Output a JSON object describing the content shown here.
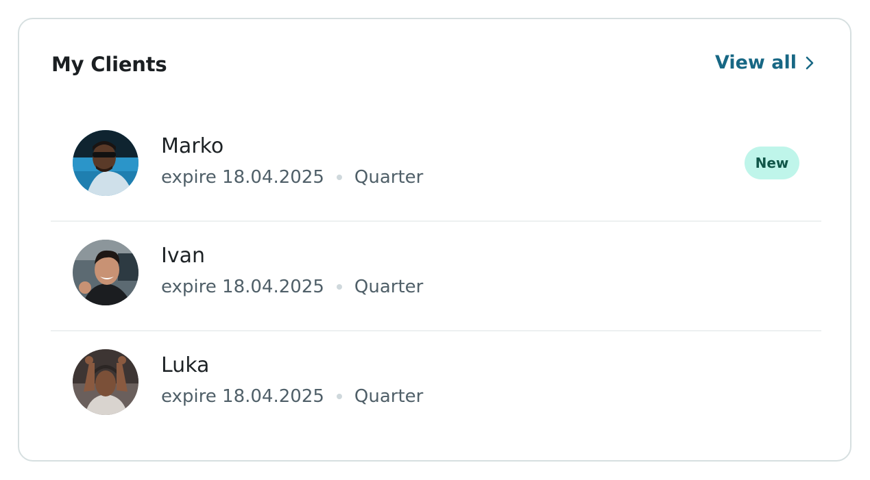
{
  "card": {
    "title": "My Clients",
    "view_all_label": "View all"
  },
  "clients": [
    {
      "name": "Marko",
      "expire": "expire 18.04.2025",
      "plan": "Quarter",
      "badge": "New"
    },
    {
      "name": "Ivan",
      "expire": "expire 18.04.2025",
      "plan": "Quarter"
    },
    {
      "name": "Luka",
      "expire": "expire 18.04.2025",
      "plan": "Quarter"
    }
  ],
  "colors": {
    "accent": "#176784",
    "badge_bg": "#bff5ea",
    "badge_text": "#115749",
    "border": "#d6dfe0"
  },
  "icons": {
    "view_all": "chevron-right-icon"
  }
}
